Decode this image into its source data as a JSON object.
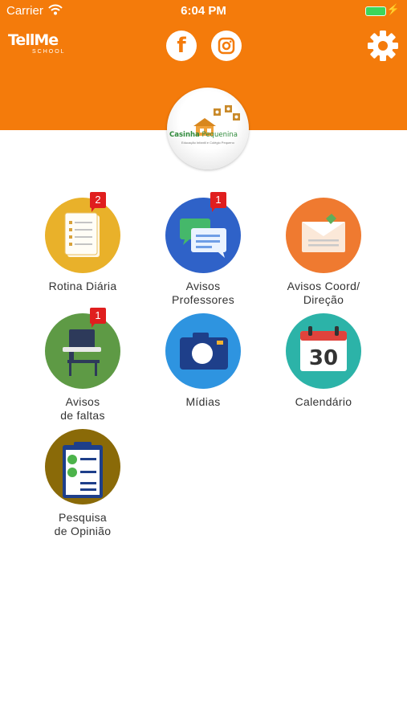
{
  "status": {
    "carrier": "Carrier",
    "time": "6:04 PM"
  },
  "header": {
    "logo_main": "TellMe",
    "logo_sub": "SCHOOL",
    "facebook_glyph": "f"
  },
  "school": {
    "name_part1": "Casinha",
    "name_part2": "Pequenina",
    "subtitle": "Educação Infantil e Colégio Pequeno"
  },
  "tiles": [
    {
      "label_line1": "Rotina Diária",
      "label_line2": "",
      "badge": "2",
      "color": "#E9B12A",
      "icon": "clipboard-list-icon"
    },
    {
      "label_line1": "Avisos",
      "label_line2": "Professores",
      "badge": "1",
      "color": "#2F62C8",
      "icon": "chat-bubbles-icon"
    },
    {
      "label_line1": "Avisos Coord/",
      "label_line2": "Direção",
      "badge": "",
      "color": "#EF7A30",
      "icon": "envelope-icon"
    },
    {
      "label_line1": "Avisos",
      "label_line2": "de faltas",
      "badge": "1",
      "color": "#5E9A45",
      "icon": "school-desk-icon"
    },
    {
      "label_line1": "Mídias",
      "label_line2": "",
      "badge": "",
      "color": "#2E94E0",
      "icon": "camera-icon"
    },
    {
      "label_line1": "Calendário",
      "label_line2": "",
      "badge": "",
      "color": "#2CB3A8",
      "icon": "calendar-icon",
      "calendar_day": "30"
    },
    {
      "label_line1": "Pesquisa",
      "label_line2": "de Opinião",
      "badge": "",
      "color": "#8A6A08",
      "icon": "survey-clipboard-icon"
    }
  ],
  "colors": {
    "header": "#F47B0B",
    "badge": "#E01E1E"
  }
}
